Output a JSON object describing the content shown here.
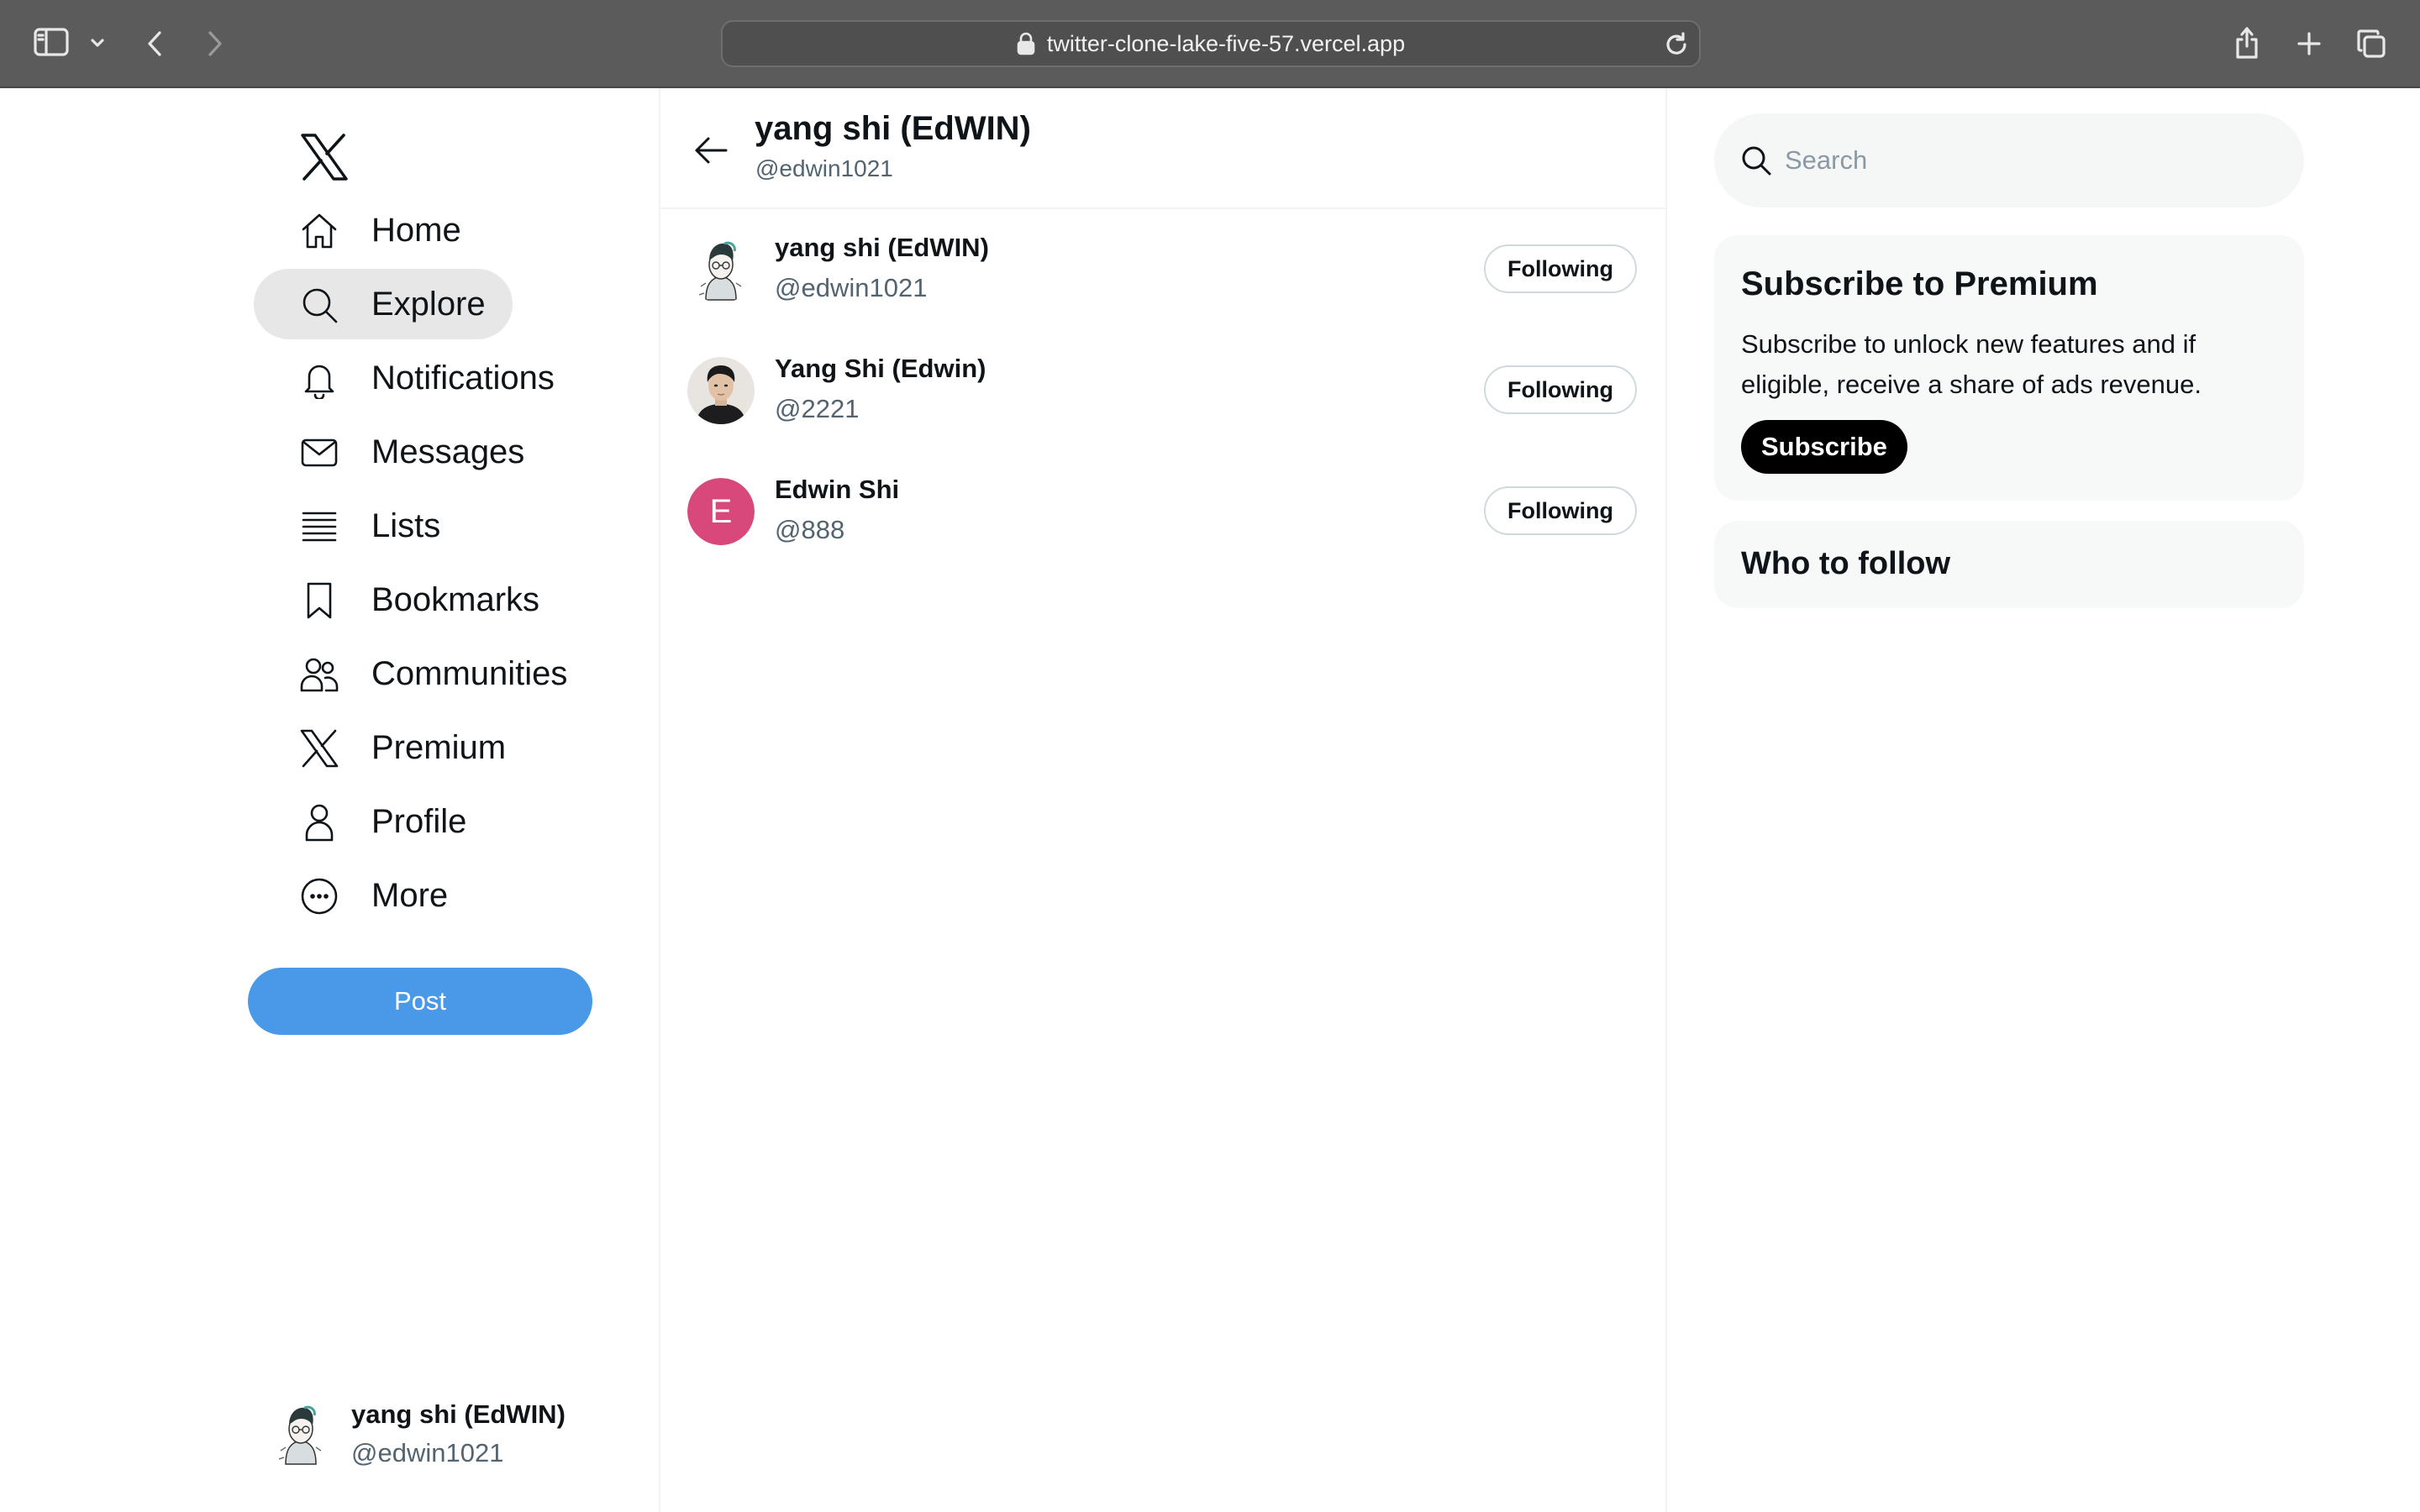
{
  "browser": {
    "url": "twitter-clone-lake-five-57.vercel.app",
    "icons": [
      "sidebar-icon",
      "chevron-down-icon",
      "back-icon",
      "forward-icon",
      "lock-icon",
      "reload-icon",
      "share-icon",
      "plus-icon",
      "tabs-icon"
    ]
  },
  "nav": {
    "items": [
      {
        "label": "Home",
        "icon": "home-icon"
      },
      {
        "label": "Explore",
        "icon": "search-icon",
        "active": true
      },
      {
        "label": "Notifications",
        "icon": "bell-icon"
      },
      {
        "label": "Messages",
        "icon": "mail-icon"
      },
      {
        "label": "Lists",
        "icon": "list-icon"
      },
      {
        "label": "Bookmarks",
        "icon": "bookmark-icon"
      },
      {
        "label": "Communities",
        "icon": "people-icon"
      },
      {
        "label": "Premium",
        "icon": "x-logo-icon"
      },
      {
        "label": "Profile",
        "icon": "person-icon"
      },
      {
        "label": "More",
        "icon": "more-circle-icon"
      }
    ],
    "post_label": "Post",
    "me": {
      "name": "yang shi (EdWIN)",
      "handle": "@edwin1021"
    }
  },
  "header": {
    "title": "yang shi (EdWIN)",
    "handle": "@edwin1021"
  },
  "users": [
    {
      "name": "yang shi (EdWIN)",
      "handle": "@edwin1021",
      "button": "Following",
      "avatar": "sketch-avatar"
    },
    {
      "name": "Yang Shi (Edwin)",
      "handle": "@2221",
      "button": "Following",
      "avatar": "photo-avatar"
    },
    {
      "name": "Edwin Shi",
      "handle": "@888",
      "button": "Following",
      "avatar": "letter-avatar",
      "letter": "E"
    }
  ],
  "sidebar": {
    "search_placeholder": "Search",
    "premium": {
      "title": "Subscribe to Premium",
      "description": "Subscribe to unlock new features and if eligible, receive a share of ads revenue.",
      "button": "Subscribe"
    },
    "who_to_follow": "Who to follow"
  },
  "colors": {
    "accent": "#4a99e9",
    "active_nav_bg": "#e7e7e7",
    "letter_avatar": "#d9487a",
    "secondary_text": "#536471"
  }
}
